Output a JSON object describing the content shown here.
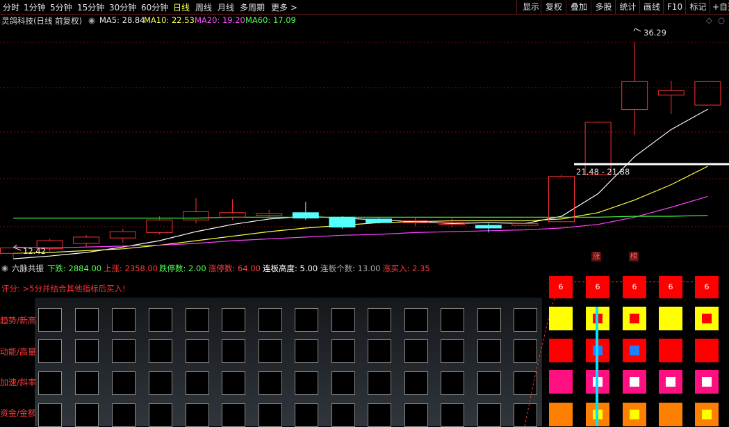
{
  "toolbar": {
    "tabs": [
      "分时",
      "1分钟",
      "5分钟",
      "15分钟",
      "30分钟",
      "60分钟",
      "日线",
      "周线",
      "月线",
      "多周期",
      "更多 >"
    ],
    "active_tab": "日线",
    "right_buttons": [
      "显示",
      "复权",
      "叠加",
      "多股",
      "统计",
      "画线",
      "F10",
      "标记",
      "+自选"
    ]
  },
  "info": {
    "stock_name": "灵鸽科技(日线 前复权)",
    "ma5": "MA5: 28.84",
    "ma10": "MA10: 22.53",
    "ma20": "MA20: 19.20",
    "ma60": "MA60: 17.09"
  },
  "chart_data": {
    "type": "candlestick",
    "high_label": "36.29",
    "low_label": "12.42",
    "box_label": "21.48 - 21.88",
    "price_range": [
      12.0,
      38.0
    ],
    "candles": [
      {
        "o": 12.9,
        "c": 13.5,
        "h": 13.6,
        "l": 12.4
      },
      {
        "o": 13.4,
        "c": 14.3,
        "h": 14.5,
        "l": 13.1
      },
      {
        "o": 14.0,
        "c": 14.7,
        "h": 14.9,
        "l": 13.6
      },
      {
        "o": 14.6,
        "c": 15.3,
        "h": 15.6,
        "l": 14.1
      },
      {
        "o": 15.2,
        "c": 16.6,
        "h": 17.0,
        "l": 15.0
      },
      {
        "o": 16.6,
        "c": 17.5,
        "h": 19.0,
        "l": 16.2
      },
      {
        "o": 16.9,
        "c": 17.4,
        "h": 18.9,
        "l": 16.6
      },
      {
        "o": 17.1,
        "c": 17.3,
        "h": 17.7,
        "l": 16.9
      },
      {
        "o": 17.4,
        "c": 16.8,
        "h": 18.6,
        "l": 16.6
      },
      {
        "o": 16.9,
        "c": 15.8,
        "h": 17.0,
        "l": 15.6
      },
      {
        "o": 16.7,
        "c": 16.3,
        "h": 16.8,
        "l": 16.2
      },
      {
        "o": 16.3,
        "c": 16.5,
        "h": 16.9,
        "l": 15.9
      },
      {
        "o": 16.1,
        "c": 16.3,
        "h": 16.8,
        "l": 15.8
      },
      {
        "o": 16.0,
        "c": 15.7,
        "h": 16.2,
        "l": 15.2
      },
      {
        "o": 16.0,
        "c": 16.2,
        "h": 16.3,
        "l": 15.9
      },
      {
        "o": 16.4,
        "c": 21.4,
        "h": 21.6,
        "l": 16.4
      },
      {
        "o": 21.6,
        "c": 27.4,
        "h": 27.5,
        "l": 21.6
      },
      {
        "o": 28.8,
        "c": 31.9,
        "h": 36.29,
        "l": 26.0
      },
      {
        "o": 30.4,
        "c": 30.9,
        "h": 32.0,
        "l": 28.3
      },
      {
        "o": 29.3,
        "c": 31.9,
        "h": 31.9,
        "l": 29.3
      }
    ],
    "series": [
      {
        "name": "MA5",
        "color": "#ffffff",
        "values": [
          12.3,
          12.6,
          13.0,
          13.6,
          14.3,
          15.3,
          16.1,
          16.7,
          17.0,
          16.8,
          16.6,
          16.4,
          16.2,
          16.3,
          16.2,
          17.0,
          19.5,
          23.6,
          26.6,
          28.84
        ]
      },
      {
        "name": "MA10",
        "color": "#ffff40",
        "values": [
          12.9,
          13.0,
          13.2,
          13.4,
          13.8,
          14.3,
          14.8,
          15.3,
          15.7,
          16.0,
          16.3,
          16.4,
          16.5,
          16.5,
          16.5,
          16.7,
          17.4,
          18.8,
          20.5,
          22.53
        ]
      },
      {
        "name": "MA20",
        "color": "#ff40ff",
        "values": [
          13.6,
          13.5,
          13.6,
          13.7,
          13.8,
          14.0,
          14.3,
          14.5,
          14.7,
          14.9,
          15.0,
          15.2,
          15.3,
          15.4,
          15.5,
          15.7,
          16.1,
          16.9,
          18.0,
          19.2
        ]
      },
      {
        "name": "MA60",
        "color": "#40ff40",
        "values": [
          16.8,
          16.8,
          16.8,
          16.8,
          16.8,
          16.8,
          16.9,
          16.9,
          16.9,
          16.9,
          16.9,
          16.9,
          16.9,
          16.9,
          16.9,
          16.9,
          16.9,
          17.0,
          17.0,
          17.09
        ]
      }
    ]
  },
  "indicator": {
    "title": "六脉共振",
    "down": "下跌: 2884.00",
    "up": "上涨: 2358.00",
    "limit_down": "跌停数: 2.00",
    "limit_up": "涨停数: 64.00",
    "board_height": "连板高度: 5.00",
    "board_count": "连板个数: 13.00",
    "buy": "涨买入: 2.35"
  },
  "hint": "评分: >5分并结合其他指标后买入!",
  "rows": [
    "趋势/新高",
    "动能/高量",
    "加速/斜率",
    "资金/金额"
  ],
  "tags": [
    "涨",
    "榜"
  ],
  "scores": [
    "6",
    "6",
    "6",
    "6",
    "6"
  ],
  "colors": {
    "up": "#ff3232",
    "down": "#54ffff",
    "bg": "#000000",
    "grid": "#7a1010"
  }
}
